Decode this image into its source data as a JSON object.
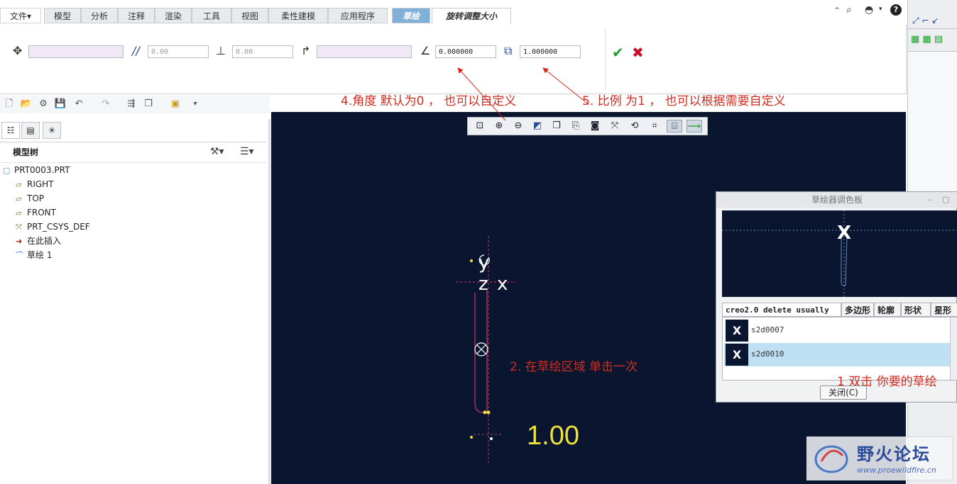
{
  "ribbon_tabs": [
    {
      "label": "文件▾",
      "kind": "file"
    },
    {
      "label": "模型",
      "kind": "normal"
    },
    {
      "label": "分析",
      "kind": "normal"
    },
    {
      "label": "注释",
      "kind": "normal"
    },
    {
      "label": "渲染",
      "kind": "normal"
    },
    {
      "label": "工具",
      "kind": "normal"
    },
    {
      "label": "视图",
      "kind": "normal"
    },
    {
      "label": "柔性建模",
      "kind": "normal"
    },
    {
      "label": "应用程序",
      "kind": "normal"
    },
    {
      "label": "草绘",
      "kind": "sketch"
    },
    {
      "label": "旋转调整大小",
      "kind": "active"
    }
  ],
  "ribbon": {
    "translate_value": "",
    "parallel_value": "0.00",
    "perpendicular_value": "0.00",
    "reference_value": "",
    "angle_value": "0.000000",
    "scale_value": "1.000000"
  },
  "left_panel": {
    "header": "模型树",
    "tree": [
      {
        "label": "PRT0003.PRT",
        "icon": "part-icon"
      },
      {
        "label": "RIGHT",
        "icon": "datum-plane-icon"
      },
      {
        "label": "TOP",
        "icon": "datum-plane-icon"
      },
      {
        "label": "FRONT",
        "icon": "datum-plane-icon"
      },
      {
        "label": "PRT_CSYS_DEF",
        "icon": "csys-icon"
      },
      {
        "label": "在此插入",
        "icon": "insert-arrow-icon"
      },
      {
        "label": "草绘 1",
        "icon": "sketch-icon"
      }
    ]
  },
  "canvas": {
    "axis_labels": {
      "y": "y",
      "z": "z",
      "x": "x"
    },
    "scale_text": "1.00"
  },
  "annotations": {
    "a1": "1 双击 你要的草绘",
    "a2": "2. 在草绘区域 单击一次",
    "a4": "4.角度 默认为0 ， 也可以自定义",
    "a5": "5. 比例 为1 ， 也可以根据需要自定义"
  },
  "palette": {
    "title": "草绘器调色板",
    "tabs": [
      "creo2.0 delete usually",
      "多边形",
      "轮廓",
      "形状",
      "星形"
    ],
    "items": [
      {
        "label": "s2d0007",
        "selected": false
      },
      {
        "label": "s2d0010",
        "selected": true
      }
    ],
    "close_label": "关闭(C)"
  },
  "watermark": {
    "title": "野火论坛",
    "url": "www.proewildfire.cn"
  },
  "colors": {
    "canvas_bg": "#0a1630",
    "annotation": "#d32b1e",
    "selection": "#bfe0f2",
    "sketch_line": "#d6336c",
    "scale_text": "#f0e23a"
  }
}
